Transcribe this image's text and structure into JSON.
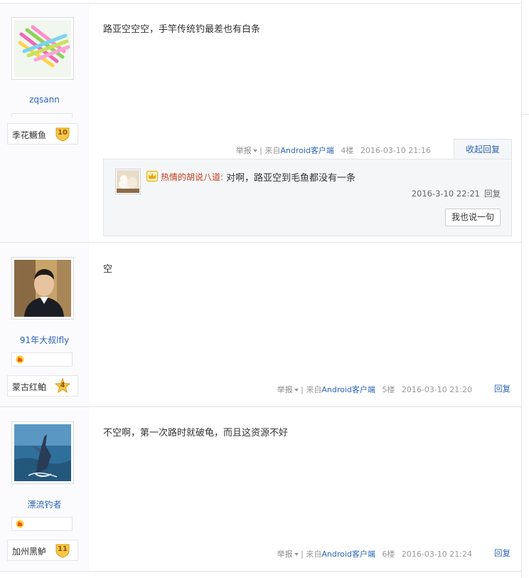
{
  "posts": [
    {
      "username": "zqsann",
      "badge_name": "季花鳜鱼",
      "badge_level": "10",
      "content": "路亚空空空，手竿传统钓最差也有白条",
      "report": "举报",
      "from_prefix": "| 来自",
      "from_client": "Android客户端",
      "floor": "4楼",
      "time": "2016-03-10 21:16",
      "reply_action": "收起回复",
      "subreplies": [
        {
          "name": "热情的胡说八道:",
          "text": "对啊，路亚空到毛鱼都没有一条",
          "time": "2016-3-10 22:21",
          "reply": "回复"
        }
      ],
      "say_button": "我也说一句"
    },
    {
      "username": "91年大叔lfly",
      "badge_name": "蒙古红鲌",
      "badge_level": "4",
      "content": "空",
      "report": "举报",
      "from_prefix": "| 来自",
      "from_client": "Android客户端",
      "floor": "5楼",
      "time": "2016-03-10 21:20",
      "reply_action": "回复"
    },
    {
      "username": "漂流钓者",
      "badge_name": "加州黑鲈",
      "badge_level": "11",
      "content": "不空啊，第一次路时就破龟，而且这资源不好",
      "report": "举报",
      "from_prefix": "| 来自",
      "from_client": "Android客户端",
      "floor": "6楼",
      "time": "2016-03-10 21:24",
      "reply_action": "回复"
    }
  ],
  "icons": {
    "crown_color": "#f0a000",
    "badge_color": "#f7c64a",
    "level_flame_color": "#e8551e"
  }
}
